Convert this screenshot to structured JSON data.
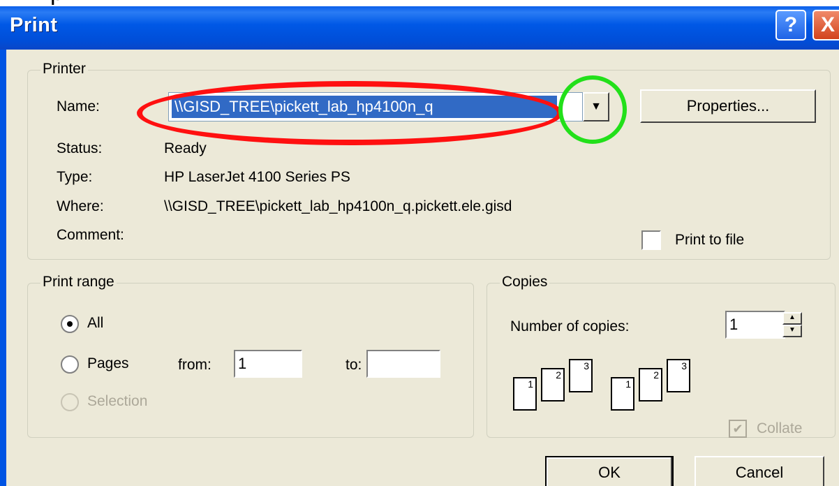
{
  "page_header_fragment": "p",
  "dialog": {
    "title": "Print",
    "help_glyph": "?",
    "close_glyph": "X",
    "accent_color": "#0054e3"
  },
  "printer": {
    "legend": "Printer",
    "name_label": "Name:",
    "name_value": "\\\\GISD_TREE\\pickett_lab_hp4100n_q",
    "properties_label": "Properties...",
    "status_label": "Status:",
    "status_value": "Ready",
    "type_label": "Type:",
    "type_value": "HP LaserJet 4100 Series PS",
    "where_label": "Where:",
    "where_value": "\\\\GISD_TREE\\pickett_lab_hp4100n_q.pickett.ele.gisd",
    "comment_label": "Comment:",
    "print_to_file_label": "Print to file",
    "print_to_file_checked": false
  },
  "print_range": {
    "legend": "Print range",
    "all_label": "All",
    "pages_label": "Pages",
    "from_label": "from:",
    "from_value": "1",
    "to_label": "to:",
    "to_value": "",
    "selection_label": "Selection",
    "selected": "All"
  },
  "copies": {
    "legend": "Copies",
    "number_label": "Number of copies:",
    "number_value": "1",
    "collate_label": "Collate",
    "collate_checked": true,
    "collate_enabled": false,
    "page_numbers": [
      "1",
      "2",
      "3"
    ]
  },
  "buttons": {
    "ok_label": "OK",
    "cancel_label": "Cancel"
  },
  "annotations": {
    "red_ellipse_color": "#ff1010",
    "green_circle_color": "#22e01a"
  }
}
